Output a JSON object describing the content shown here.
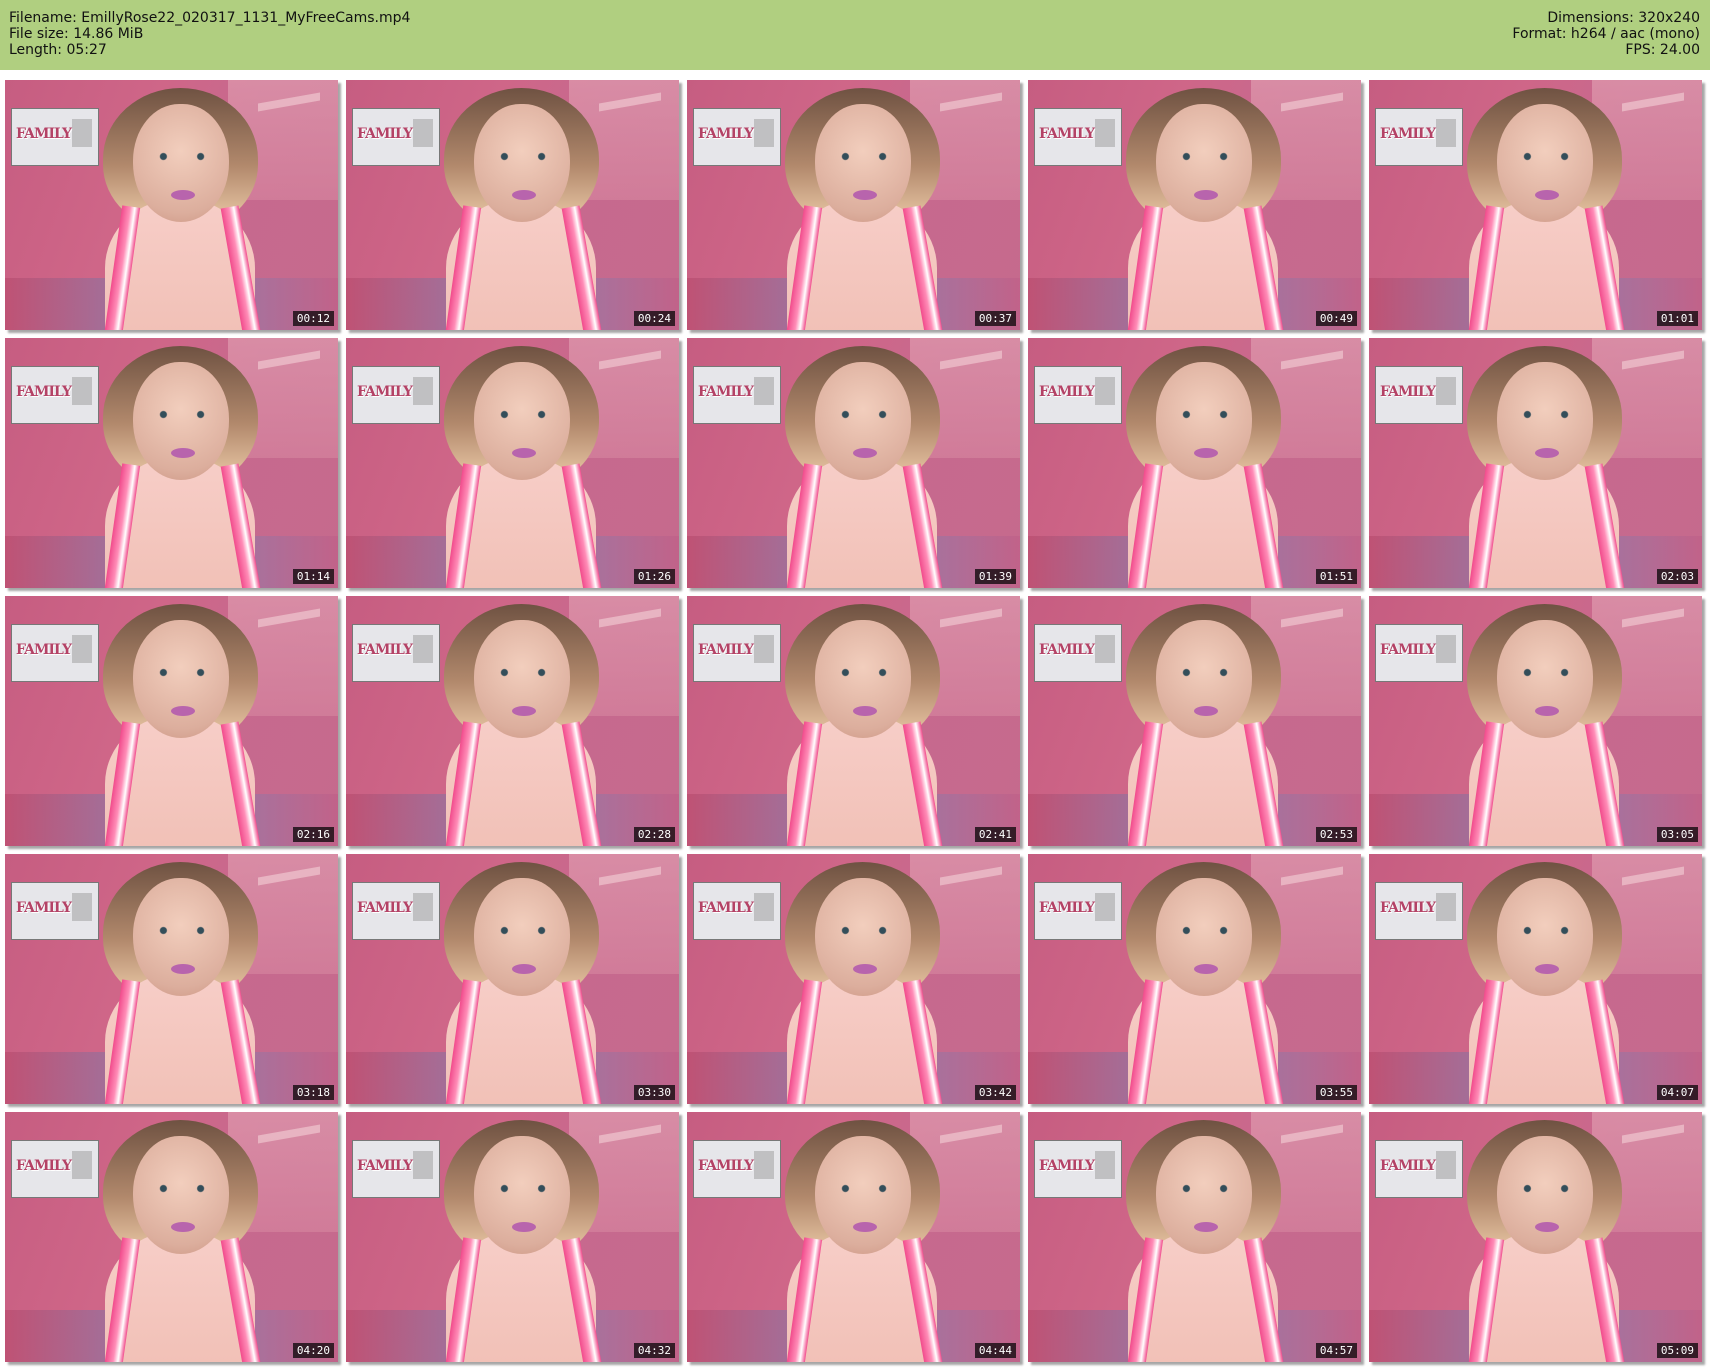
{
  "header": {
    "left": {
      "filename": "Filename: EmillyRose22_020317_1131_MyFreeCams.mp4",
      "file_size": "File size: 14.86 MiB",
      "length": "Length: 05:27"
    },
    "right": {
      "dimensions": "Dimensions: 320x240",
      "format": "Format: h264 / aac (mono)",
      "fps": "FPS: 24.00"
    },
    "background_color": "#b0cf80"
  },
  "poster_text": "FAMILY",
  "thumbnails": [
    {
      "time": "00:12"
    },
    {
      "time": "00:24"
    },
    {
      "time": "00:37"
    },
    {
      "time": "00:49"
    },
    {
      "time": "01:01"
    },
    {
      "time": "01:14"
    },
    {
      "time": "01:26"
    },
    {
      "time": "01:39"
    },
    {
      "time": "01:51"
    },
    {
      "time": "02:03"
    },
    {
      "time": "02:16"
    },
    {
      "time": "02:28"
    },
    {
      "time": "02:41"
    },
    {
      "time": "02:53"
    },
    {
      "time": "03:05"
    },
    {
      "time": "03:18"
    },
    {
      "time": "03:30"
    },
    {
      "time": "03:42"
    },
    {
      "time": "03:55"
    },
    {
      "time": "04:07"
    },
    {
      "time": "04:20"
    },
    {
      "time": "04:32"
    },
    {
      "time": "04:44"
    },
    {
      "time": "04:57"
    },
    {
      "time": "05:09"
    }
  ]
}
